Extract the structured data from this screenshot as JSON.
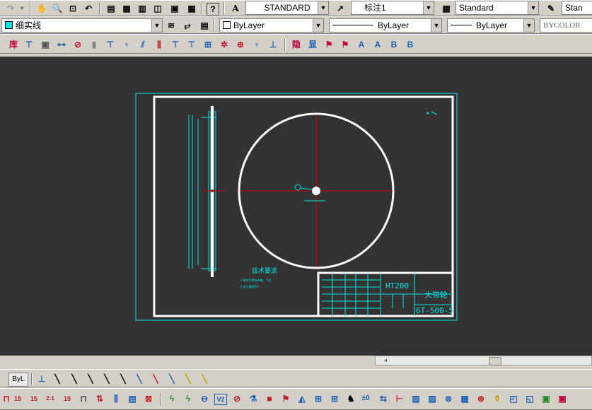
{
  "toolbar_top": {
    "text_style": "STANDARD",
    "dim_style": "标注1",
    "table_style": "Standard",
    "multileader_style": "Stan"
  },
  "layers": {
    "current_layer": "细实线",
    "color": "ByLayer",
    "linetype": "ByLayer",
    "lineweight": "ByLayer",
    "plotstyle": "BYCOLOR"
  },
  "toolbar_third": {
    "lib_icon": "库",
    "hide_icon": "隐",
    "show_icon": "显"
  },
  "bottom_toolbar": {
    "bylayer_btn": "ByL",
    "dim_15a": "15",
    "dim_15b": "15",
    "dim_21": "2:1",
    "dim_15c": "15",
    "dim_v2": "V2",
    "dim_zero": "±0"
  },
  "drawing": {
    "material": "HT200",
    "part_name": "大带轮",
    "drawing_number": "6T-500-5",
    "tech_req_title": "技术要求",
    "tech_req_line1": "1.铸件不得有砂眼、气孔",
    "tech_req_line2": "2.未注圆角R3"
  },
  "colors": {
    "canvas_bg": "#333333",
    "cyan": "#00e5e5",
    "red": "#cc0000",
    "white": "#ffffff",
    "toolbar_bg": "#d4d0c8"
  }
}
